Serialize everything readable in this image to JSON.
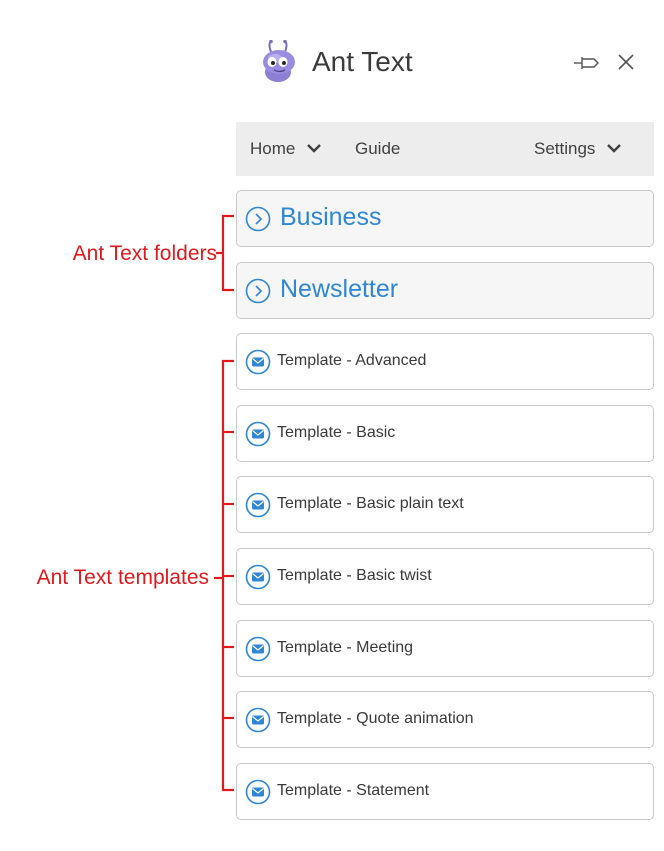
{
  "app": {
    "title": "Ant Text"
  },
  "header": {
    "logo_icon": "ant-logo-icon",
    "pin_icon": "pin-icon",
    "close_icon": "close-icon"
  },
  "nav": {
    "home_label": "Home",
    "guide_label": "Guide",
    "settings_label": "Settings"
  },
  "folders": [
    {
      "label": "Business",
      "icon": "chevron-circle-right-icon"
    },
    {
      "label": "Newsletter",
      "icon": "chevron-circle-right-icon"
    }
  ],
  "templates": [
    {
      "label": "Template - Advanced",
      "icon": "mail-circle-icon"
    },
    {
      "label": "Template - Basic",
      "icon": "mail-circle-icon"
    },
    {
      "label": "Template - Basic plain text",
      "icon": "mail-circle-icon"
    },
    {
      "label": "Template - Basic twist",
      "icon": "mail-circle-icon"
    },
    {
      "label": "Template - Meeting",
      "icon": "mail-circle-icon"
    },
    {
      "label": "Template - Quote animation",
      "icon": "mail-circle-icon"
    },
    {
      "label": "Template - Statement",
      "icon": "mail-circle-icon"
    }
  ],
  "annotations": {
    "folders_label": "Ant Text folders",
    "templates_label": "Ant Text templates"
  },
  "colors": {
    "accent": "#2e86d4",
    "annotation": "#e0191d",
    "navbar_bg": "#ededed",
    "folder_bg": "#f6f6f6"
  }
}
